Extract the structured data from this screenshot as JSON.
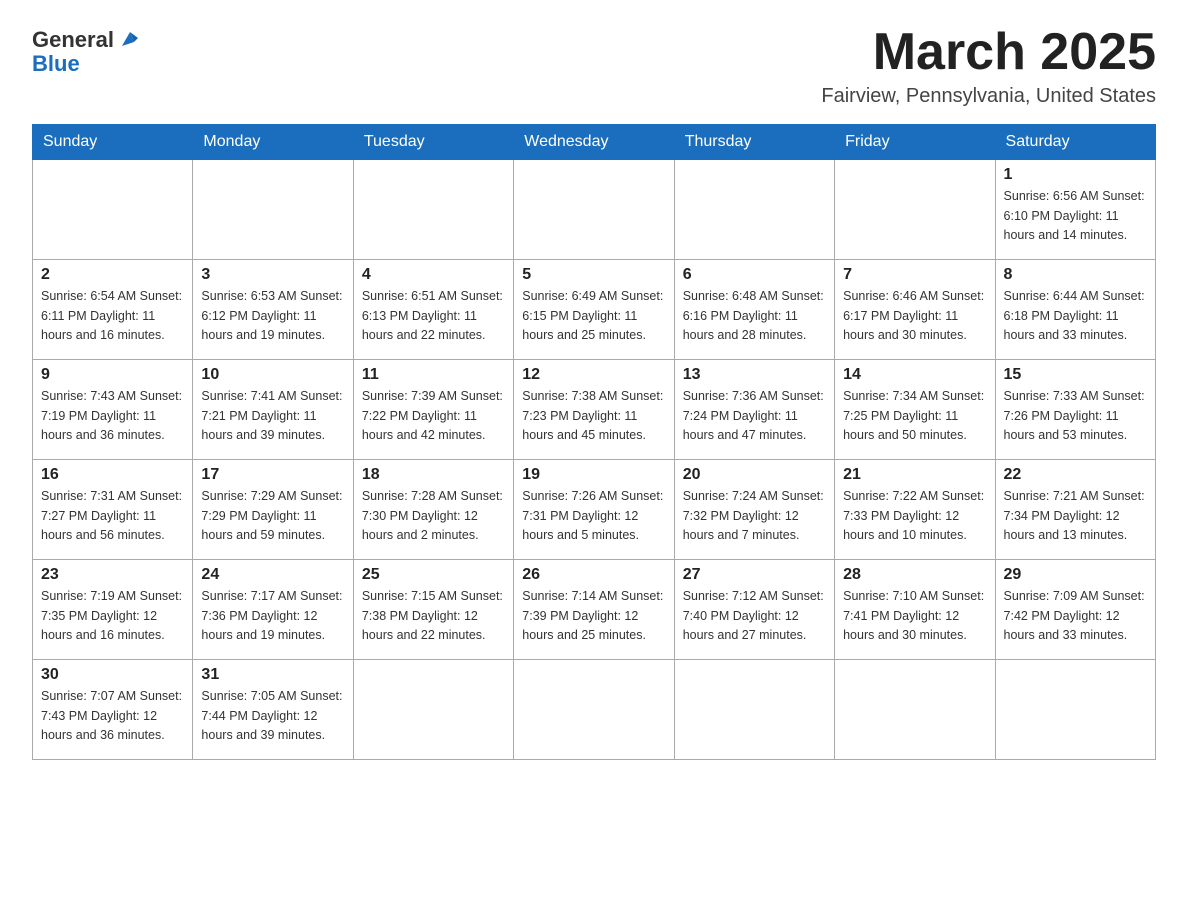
{
  "header": {
    "logo_general": "General",
    "logo_blue": "Blue",
    "month_title": "March 2025",
    "location": "Fairview, Pennsylvania, United States"
  },
  "weekdays": [
    "Sunday",
    "Monday",
    "Tuesday",
    "Wednesday",
    "Thursday",
    "Friday",
    "Saturday"
  ],
  "weeks": [
    [
      {
        "day": "",
        "info": ""
      },
      {
        "day": "",
        "info": ""
      },
      {
        "day": "",
        "info": ""
      },
      {
        "day": "",
        "info": ""
      },
      {
        "day": "",
        "info": ""
      },
      {
        "day": "",
        "info": ""
      },
      {
        "day": "1",
        "info": "Sunrise: 6:56 AM\nSunset: 6:10 PM\nDaylight: 11 hours\nand 14 minutes."
      }
    ],
    [
      {
        "day": "2",
        "info": "Sunrise: 6:54 AM\nSunset: 6:11 PM\nDaylight: 11 hours\nand 16 minutes."
      },
      {
        "day": "3",
        "info": "Sunrise: 6:53 AM\nSunset: 6:12 PM\nDaylight: 11 hours\nand 19 minutes."
      },
      {
        "day": "4",
        "info": "Sunrise: 6:51 AM\nSunset: 6:13 PM\nDaylight: 11 hours\nand 22 minutes."
      },
      {
        "day": "5",
        "info": "Sunrise: 6:49 AM\nSunset: 6:15 PM\nDaylight: 11 hours\nand 25 minutes."
      },
      {
        "day": "6",
        "info": "Sunrise: 6:48 AM\nSunset: 6:16 PM\nDaylight: 11 hours\nand 28 minutes."
      },
      {
        "day": "7",
        "info": "Sunrise: 6:46 AM\nSunset: 6:17 PM\nDaylight: 11 hours\nand 30 minutes."
      },
      {
        "day": "8",
        "info": "Sunrise: 6:44 AM\nSunset: 6:18 PM\nDaylight: 11 hours\nand 33 minutes."
      }
    ],
    [
      {
        "day": "9",
        "info": "Sunrise: 7:43 AM\nSunset: 7:19 PM\nDaylight: 11 hours\nand 36 minutes."
      },
      {
        "day": "10",
        "info": "Sunrise: 7:41 AM\nSunset: 7:21 PM\nDaylight: 11 hours\nand 39 minutes."
      },
      {
        "day": "11",
        "info": "Sunrise: 7:39 AM\nSunset: 7:22 PM\nDaylight: 11 hours\nand 42 minutes."
      },
      {
        "day": "12",
        "info": "Sunrise: 7:38 AM\nSunset: 7:23 PM\nDaylight: 11 hours\nand 45 minutes."
      },
      {
        "day": "13",
        "info": "Sunrise: 7:36 AM\nSunset: 7:24 PM\nDaylight: 11 hours\nand 47 minutes."
      },
      {
        "day": "14",
        "info": "Sunrise: 7:34 AM\nSunset: 7:25 PM\nDaylight: 11 hours\nand 50 minutes."
      },
      {
        "day": "15",
        "info": "Sunrise: 7:33 AM\nSunset: 7:26 PM\nDaylight: 11 hours\nand 53 minutes."
      }
    ],
    [
      {
        "day": "16",
        "info": "Sunrise: 7:31 AM\nSunset: 7:27 PM\nDaylight: 11 hours\nand 56 minutes."
      },
      {
        "day": "17",
        "info": "Sunrise: 7:29 AM\nSunset: 7:29 PM\nDaylight: 11 hours\nand 59 minutes."
      },
      {
        "day": "18",
        "info": "Sunrise: 7:28 AM\nSunset: 7:30 PM\nDaylight: 12 hours\nand 2 minutes."
      },
      {
        "day": "19",
        "info": "Sunrise: 7:26 AM\nSunset: 7:31 PM\nDaylight: 12 hours\nand 5 minutes."
      },
      {
        "day": "20",
        "info": "Sunrise: 7:24 AM\nSunset: 7:32 PM\nDaylight: 12 hours\nand 7 minutes."
      },
      {
        "day": "21",
        "info": "Sunrise: 7:22 AM\nSunset: 7:33 PM\nDaylight: 12 hours\nand 10 minutes."
      },
      {
        "day": "22",
        "info": "Sunrise: 7:21 AM\nSunset: 7:34 PM\nDaylight: 12 hours\nand 13 minutes."
      }
    ],
    [
      {
        "day": "23",
        "info": "Sunrise: 7:19 AM\nSunset: 7:35 PM\nDaylight: 12 hours\nand 16 minutes."
      },
      {
        "day": "24",
        "info": "Sunrise: 7:17 AM\nSunset: 7:36 PM\nDaylight: 12 hours\nand 19 minutes."
      },
      {
        "day": "25",
        "info": "Sunrise: 7:15 AM\nSunset: 7:38 PM\nDaylight: 12 hours\nand 22 minutes."
      },
      {
        "day": "26",
        "info": "Sunrise: 7:14 AM\nSunset: 7:39 PM\nDaylight: 12 hours\nand 25 minutes."
      },
      {
        "day": "27",
        "info": "Sunrise: 7:12 AM\nSunset: 7:40 PM\nDaylight: 12 hours\nand 27 minutes."
      },
      {
        "day": "28",
        "info": "Sunrise: 7:10 AM\nSunset: 7:41 PM\nDaylight: 12 hours\nand 30 minutes."
      },
      {
        "day": "29",
        "info": "Sunrise: 7:09 AM\nSunset: 7:42 PM\nDaylight: 12 hours\nand 33 minutes."
      }
    ],
    [
      {
        "day": "30",
        "info": "Sunrise: 7:07 AM\nSunset: 7:43 PM\nDaylight: 12 hours\nand 36 minutes."
      },
      {
        "day": "31",
        "info": "Sunrise: 7:05 AM\nSunset: 7:44 PM\nDaylight: 12 hours\nand 39 minutes."
      },
      {
        "day": "",
        "info": ""
      },
      {
        "day": "",
        "info": ""
      },
      {
        "day": "",
        "info": ""
      },
      {
        "day": "",
        "info": ""
      },
      {
        "day": "",
        "info": ""
      }
    ]
  ]
}
